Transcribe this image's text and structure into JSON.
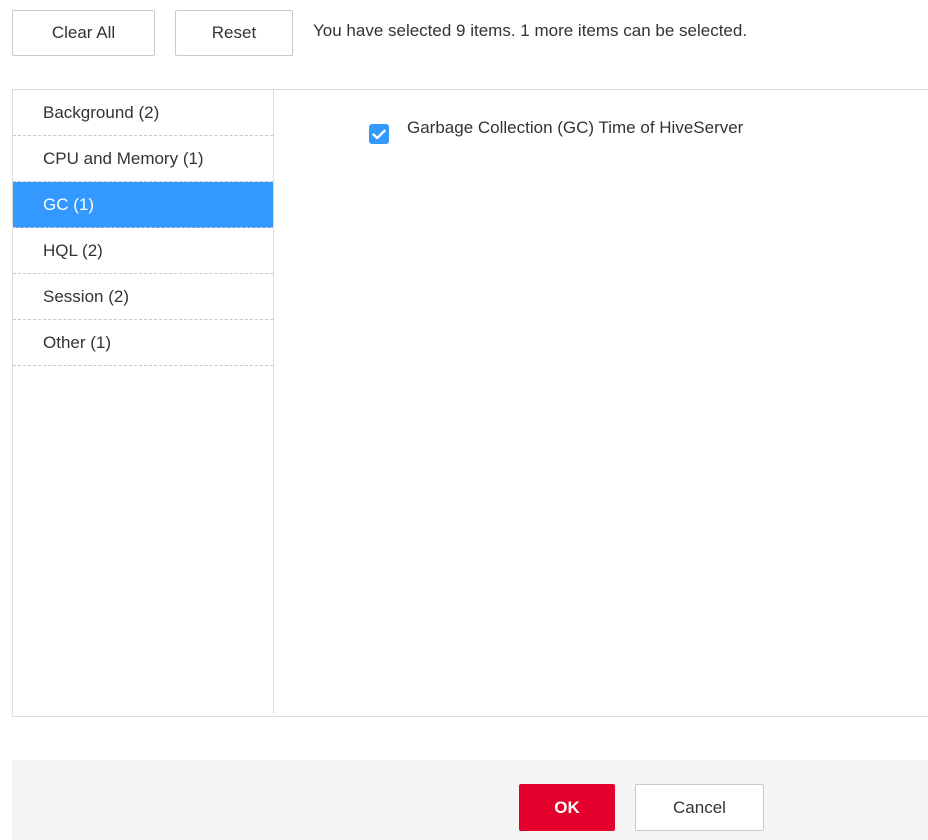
{
  "toolbar": {
    "clear_all_label": "Clear All",
    "reset_label": "Reset",
    "selection_info": "You have selected 9 items. 1 more items can be selected."
  },
  "categories": [
    {
      "label": "Background (2)",
      "active": false
    },
    {
      "label": "CPU and Memory (1)",
      "active": false
    },
    {
      "label": "GC (1)",
      "active": true
    },
    {
      "label": "HQL (2)",
      "active": false
    },
    {
      "label": "Session (2)",
      "active": false
    },
    {
      "label": "Other (1)",
      "active": false
    }
  ],
  "metrics": [
    {
      "label": "Garbage Collection (GC) Time of HiveServer",
      "checked": true,
      "icon": "check-icon"
    }
  ],
  "footer": {
    "ok_label": "OK",
    "cancel_label": "Cancel"
  },
  "colors": {
    "accent": "#3399ff",
    "primary_button": "#e3002d",
    "footer_background": "#f5f5f5"
  }
}
